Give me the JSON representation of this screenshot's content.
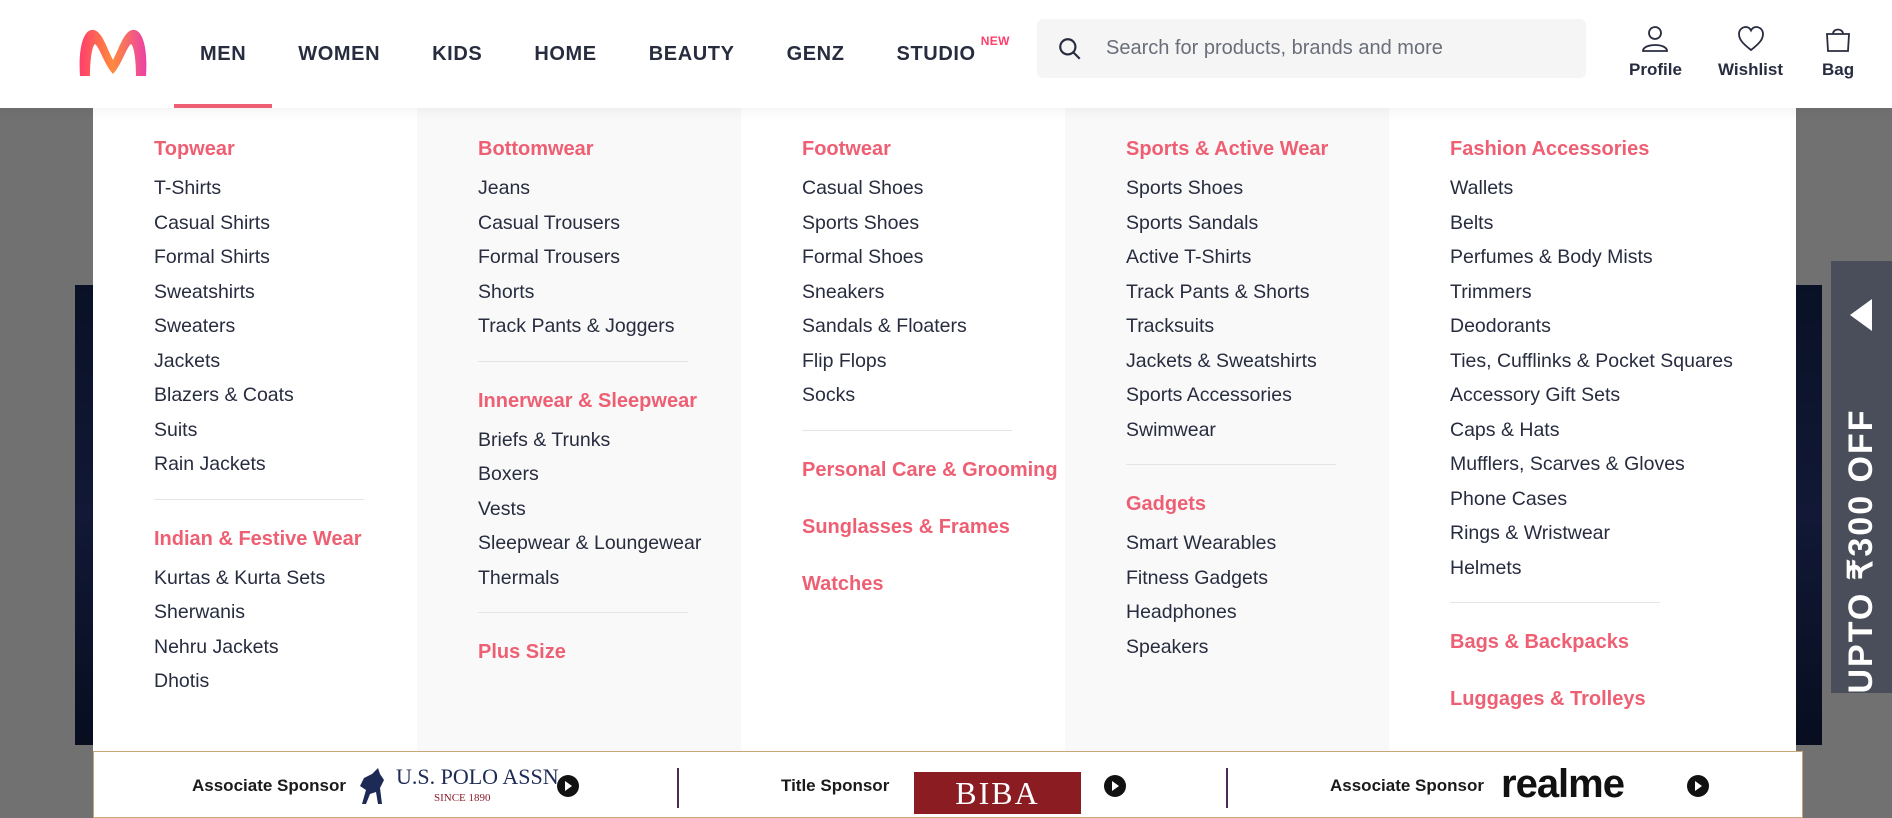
{
  "header": {
    "nav": [
      {
        "label": "MEN",
        "active": true
      },
      {
        "label": "WOMEN"
      },
      {
        "label": "KIDS"
      },
      {
        "label": "HOME"
      },
      {
        "label": "BEAUTY"
      },
      {
        "label": "GENZ"
      },
      {
        "label": "STUDIO",
        "badge": "NEW"
      }
    ],
    "search_placeholder": "Search for products, brands and more",
    "actions": {
      "profile": "Profile",
      "wishlist": "Wishlist",
      "bag": "Bag"
    }
  },
  "menu": {
    "col1": {
      "cat1": "Topwear",
      "cat1_items": [
        "T-Shirts",
        "Casual Shirts",
        "Formal Shirts",
        "Sweatshirts",
        "Sweaters",
        "Jackets",
        "Blazers & Coats",
        "Suits",
        "Rain Jackets"
      ],
      "cat2": "Indian & Festive Wear",
      "cat2_items": [
        "Kurtas & Kurta Sets",
        "Sherwanis",
        "Nehru Jackets",
        "Dhotis"
      ]
    },
    "col2": {
      "cat1": "Bottomwear",
      "cat1_items": [
        "Jeans",
        "Casual Trousers",
        "Formal Trousers",
        "Shorts",
        "Track Pants & Joggers"
      ],
      "cat2": "Innerwear & Sleepwear",
      "cat2_items": [
        "Briefs & Trunks",
        "Boxers",
        "Vests",
        "Sleepwear & Loungewear",
        "Thermals"
      ],
      "cat3": "Plus Size"
    },
    "col3": {
      "cat1": "Footwear",
      "cat1_items": [
        "Casual Shoes",
        "Sports Shoes",
        "Formal Shoes",
        "Sneakers",
        "Sandals & Floaters",
        "Flip Flops",
        "Socks"
      ],
      "cat2": "Personal Care & Grooming",
      "cat3": "Sunglasses & Frames",
      "cat4": "Watches"
    },
    "col4": {
      "cat1": "Sports & Active Wear",
      "cat1_items": [
        "Sports Shoes",
        "Sports Sandals",
        "Active T-Shirts",
        "Track Pants & Shorts",
        "Tracksuits",
        "Jackets & Sweatshirts",
        "Sports Accessories",
        "Swimwear"
      ],
      "cat2": "Gadgets",
      "cat2_items": [
        "Smart Wearables",
        "Fitness Gadgets",
        "Headphones",
        "Speakers"
      ]
    },
    "col5": {
      "cat1": "Fashion Accessories",
      "cat1_items": [
        "Wallets",
        "Belts",
        "Perfumes & Body Mists",
        "Trimmers",
        "Deodorants",
        "Ties, Cufflinks & Pocket Squares",
        "Accessory Gift Sets",
        "Caps & Hats",
        "Mufflers, Scarves & Gloves",
        "Phone Cases",
        "Rings & Wristwear",
        "Helmets"
      ],
      "cat2": "Bags & Backpacks",
      "cat3": "Luggages & Trolleys"
    }
  },
  "side_tab": {
    "text": "UPTO ₹300 OFF"
  },
  "sponsors": {
    "s1_label": "Associate Sponsor",
    "s1_brand": "U.S. POLO ASSN.",
    "s1_since": "SINCE 1890",
    "s2_label": "Title Sponsor",
    "s2_brand": "BIBA",
    "s3_label": "Associate Sponsor",
    "s3_brand": "realme"
  },
  "colors": {
    "accent": "#ff3f6c",
    "category": "#ee5f73",
    "text": "#282c3f"
  }
}
